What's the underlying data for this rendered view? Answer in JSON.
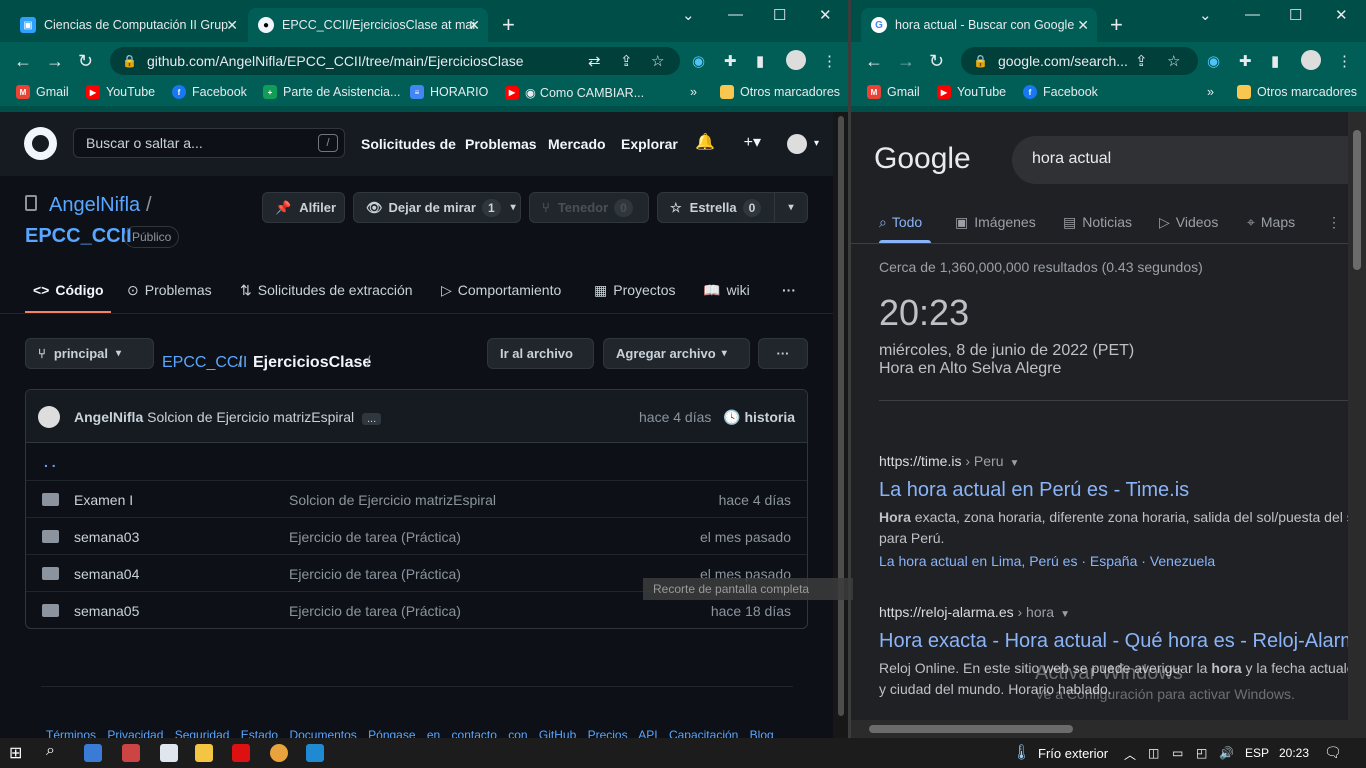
{
  "left_window": {
    "tabs": [
      {
        "title": "Ciencias de Computación II Grup",
        "color": "#2ea0ff"
      },
      {
        "title": "EPCC_CCII/EjerciciosClase at mai",
        "color": "#f0f6fc"
      }
    ],
    "url_main": "github.com/AngelNifla/EPCC_CCII/tree/main/EjerciciosClase",
    "bookmarks": [
      "Gmail",
      "YouTube",
      "Facebook",
      "Parte de Asistencia...",
      "HORARIO",
      "Como CAMBIAR..."
    ],
    "other_bookmarks": "Otros marcadores"
  },
  "github": {
    "search_placeholder": "Buscar o saltar a...",
    "slash": "/",
    "nav": [
      "Solicitudes de",
      "Problemas",
      "Mercado",
      "Explorar"
    ],
    "owner": "AngelNifla",
    "slash_sep": "/",
    "repo": "EPCC_CCII",
    "visibility": "Público",
    "pin": "Alfiler",
    "watch": "Dejar de mirar",
    "watch_count": "1",
    "fork": "Tenedor",
    "fork_count": "0",
    "star": "Estrella",
    "star_count": "0",
    "repo_tabs": [
      "Código",
      "Problemas",
      "Solicitudes de extracción",
      "Comportamiento",
      "Proyectos",
      "wiki"
    ],
    "branch": "principal",
    "crumb_root": "EPCC_CCII",
    "crumb_dir": "EjerciciosClase",
    "crumb_sep": "/",
    "goto_file": "Ir al archivo",
    "add_file": "Agregar archivo",
    "commit_author": "AngelNifla",
    "commit_msg": "Solcion de Ejercicio matrizEspiral",
    "commit_more": "...",
    "commit_age": "hace 4 días",
    "history": "historia",
    "parent_dir": ". .",
    "files": [
      {
        "name": "Examen I",
        "msg": "Solcion de Ejercicio matrizEspiral",
        "age": "hace 4 días"
      },
      {
        "name": "semana03",
        "msg": "Ejercicio de tarea (Práctica)",
        "age": "el mes pasado"
      },
      {
        "name": "semana04",
        "msg": "Ejercicio de tarea (Práctica)",
        "age": "el mes pasado"
      },
      {
        "name": "semana05",
        "msg": "Ejercicio de tarea (Práctica)",
        "age": "hace 18 días"
      }
    ],
    "footer": "Términos Privacidad Seguridad Estado Documentos Póngase en contacto con GitHub Precios API Capacitación Blog"
  },
  "tooltip": "Recorte de pantalla completa",
  "right_window": {
    "tab_title": "hora actual - Buscar con Google",
    "url_main": "google.com/search...",
    "bookmarks": [
      "Gmail",
      "YouTube",
      "Facebook"
    ],
    "other_bookmarks": "Otros marcadores"
  },
  "google": {
    "logo": "Google",
    "query": "hora actual",
    "tabs": [
      "Todo",
      "Imágenes",
      "Noticias",
      "Videos",
      "Maps",
      "M"
    ],
    "stats": "Cerca de 1,360,000,000 resultados (0.43 segundos)",
    "time": "20:23",
    "date": "miércoles, 8 de junio de 2022 (PET)",
    "place": "Hora en Alto Selva Alegre",
    "results": [
      {
        "url": "https://time.is",
        "url_path": " › Peru",
        "title": "La hora actual en Perú es - Time.is",
        "snippet_bold": "Hora",
        "snippet": " exacta, zona horaria, diferente zona horaria, salida del sol/puesta del sol para Perú.",
        "links": "La hora actual en Lima, Perú es · España · Venezuela"
      },
      {
        "url": "https://reloj-alarma.es",
        "url_path": " › hora",
        "title": "Hora exacta - Hora actual - Qué hora es - Reloj-Alarma",
        "snippet_pre": "Reloj Online. En este sitio web se puede averiguar la ",
        "snippet_bold": "hora",
        "snippet_post": " y la fecha actuales y ciudad del mundo. Horario hablado."
      }
    ]
  },
  "watermark": {
    "line1": "Activar Windows",
    "line2": "Ve a Configuración para activar Windows."
  },
  "taskbar": {
    "weather": "Frío exterior",
    "lang": "ESP",
    "clock": "20:23"
  }
}
